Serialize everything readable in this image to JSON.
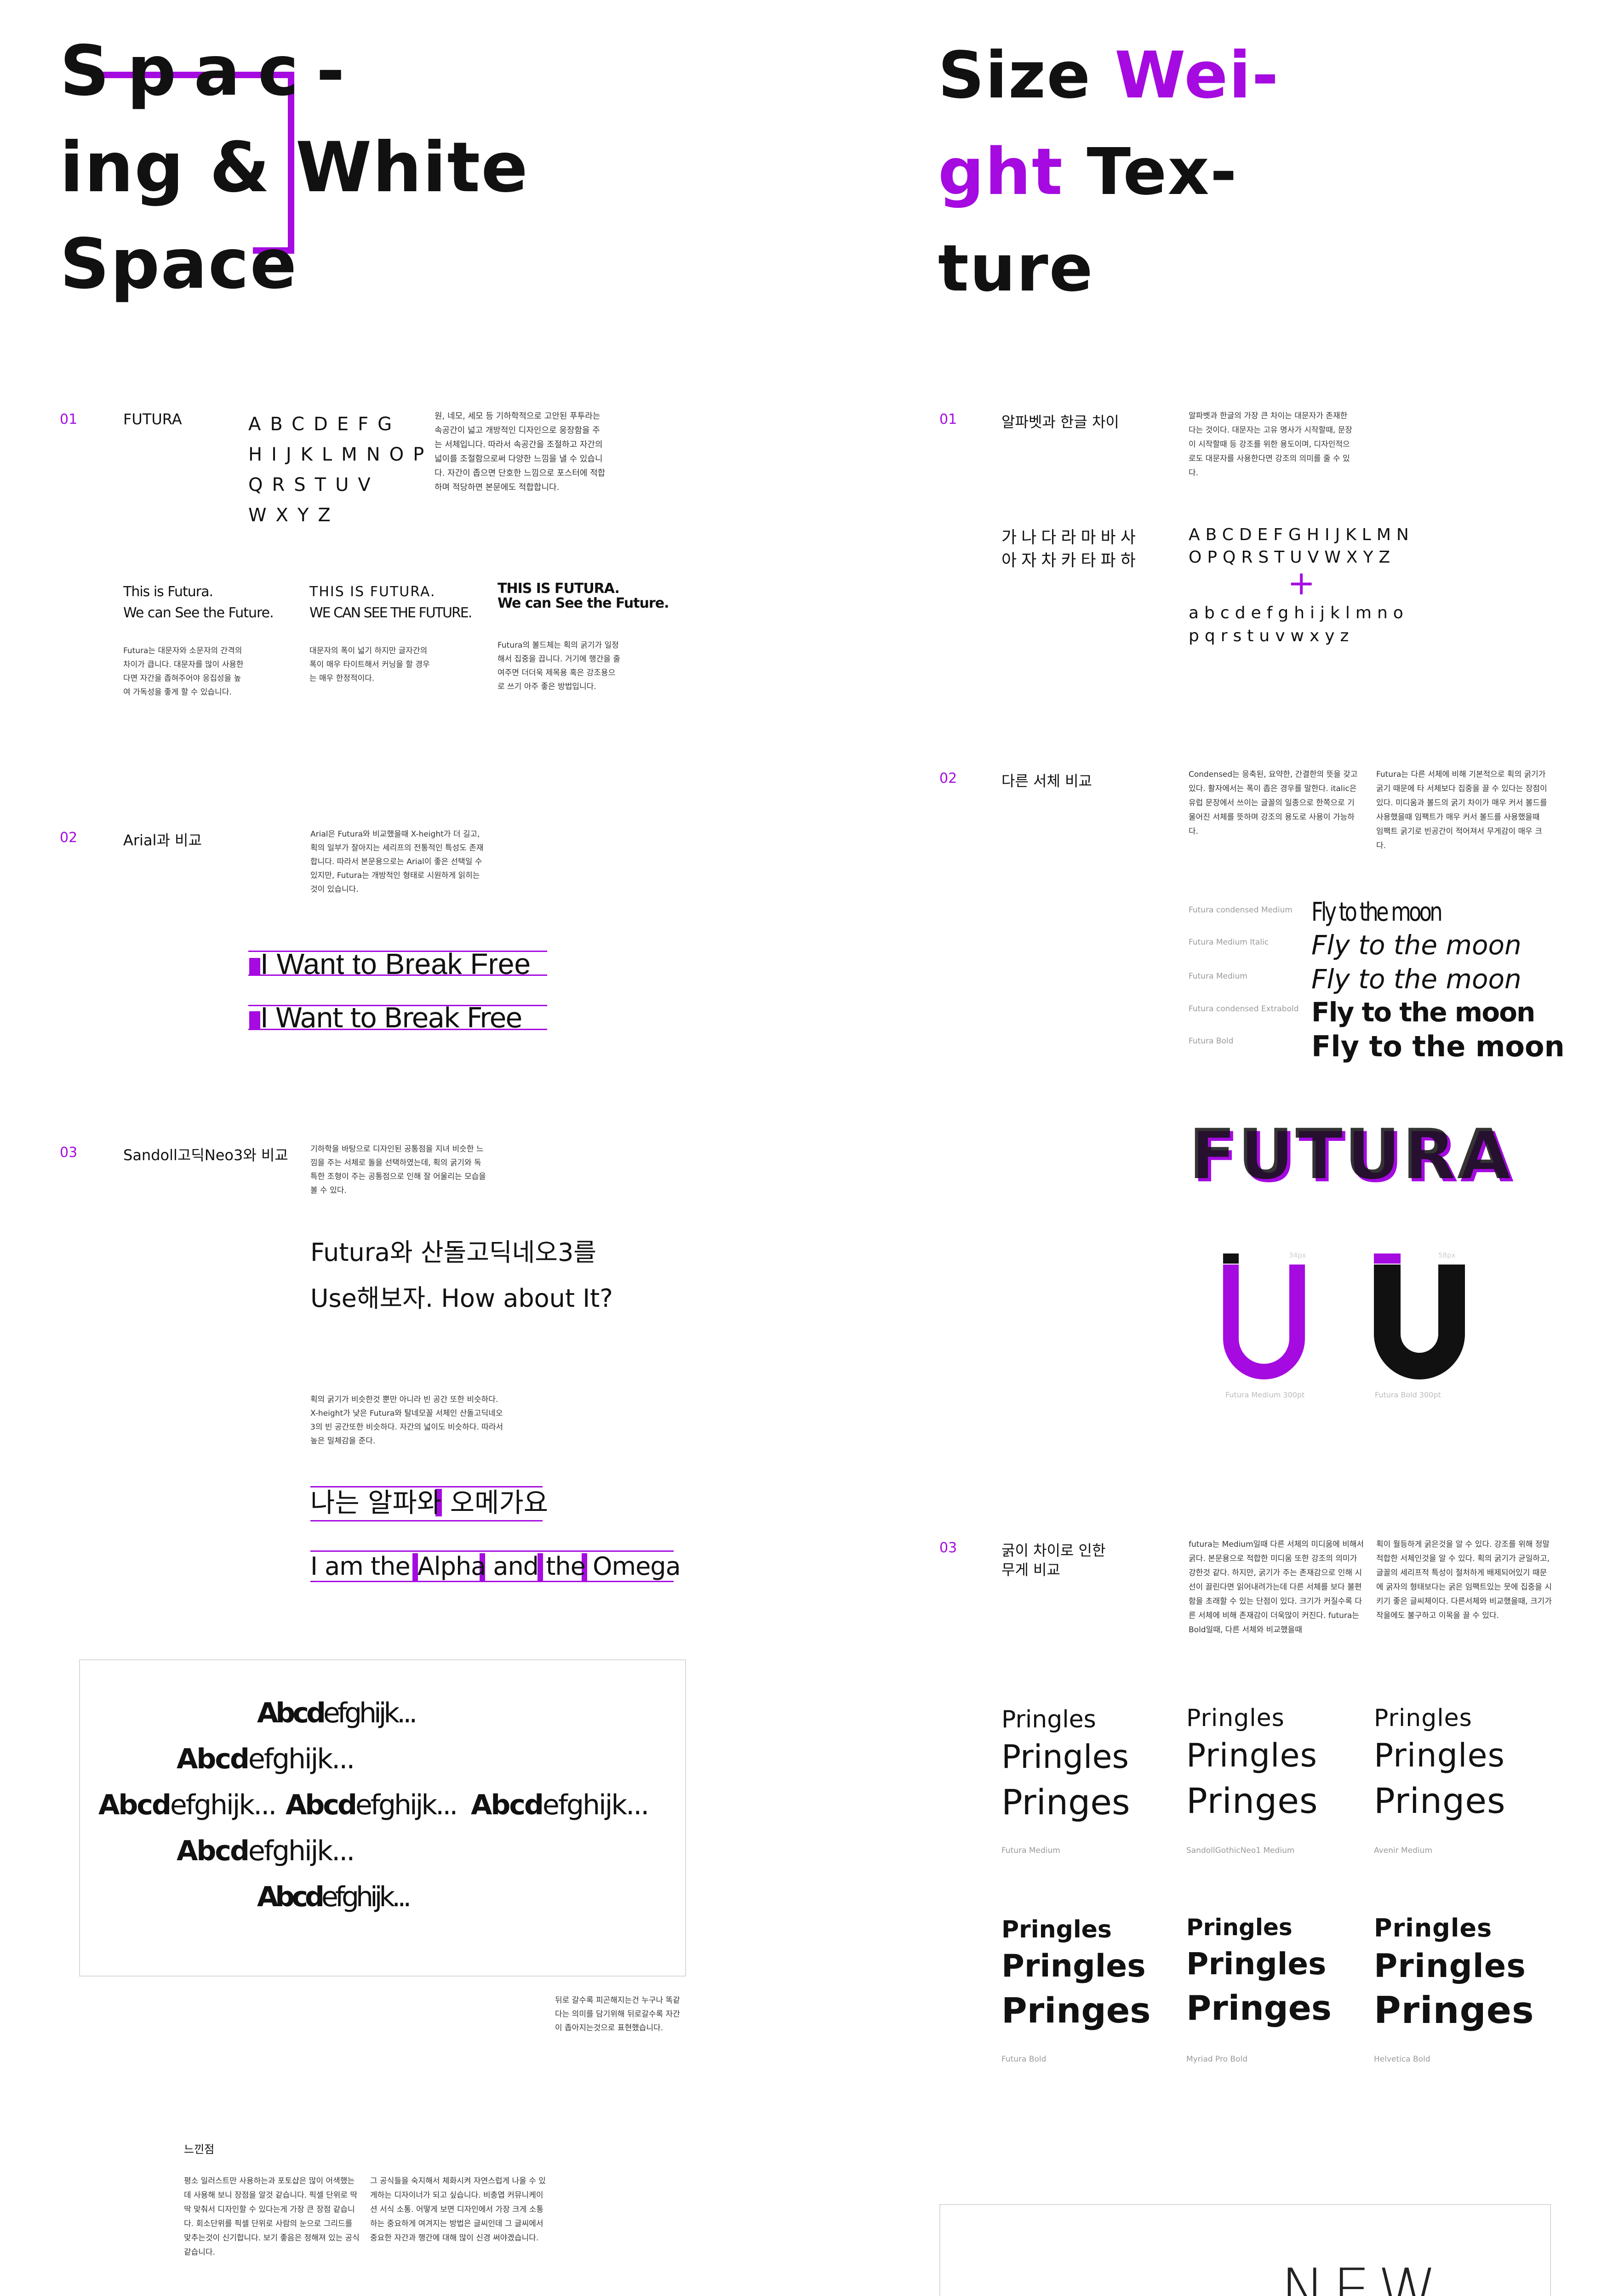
{
  "left": {
    "title_lines": [
      "Spac-",
      "ing & White",
      "Space"
    ],
    "s01": {
      "num": "01",
      "label": "FUTURA",
      "alpha_lines": [
        "ABCDEFG",
        "HIJKLMNOP",
        "QRSTUV",
        "WXYZ"
      ],
      "desc": "원, 네모, 세모 등 기하학적으로 고안된 푸투라는 속공간이 넓고 개방적인 디자인으로 웅장함을 주는 서체입니다. 따라서 속공간을 조절하고 자간의 넓이를 조절함으로써 다양한 느낌을 낼 수 있습니다. 자간이 좁으면 단호한 느낌으로 포스터에 적합하며 적당하면 본문에도 적합합니다.",
      "samples": [
        {
          "l1": "This is Futura.",
          "l2": "We can See the Future.",
          "desc": "Futura는 대문자와 소문자의 간격의 차이가 큽니다. 대문자를 많이 사용한다면 자간을 좁혀주어야 응집성을 높여 가독성을 좋게 할 수 있습니다."
        },
        {
          "l1": "THIS IS FUTURA.",
          "l2": "WE CAN SEE THE FUTURE.",
          "desc": "대문자의 폭이 넓기 하지만 글자간의 폭이 매우 타이트해서 커닝을 할 경우는 매우 한정적이다."
        },
        {
          "l1": "THIS IS FUTURA.",
          "l2": "We can See the Future.",
          "desc": "Futura의 볼드체는 획의 굵기가 일정해서 집중을 끕니다. 거기에 행간을 줄여주면 더더욱 제목용 혹은 강조용으로 쓰기 아주 좋은 방법입니다."
        }
      ]
    },
    "s02": {
      "num": "02",
      "label": "Arial과 비교",
      "desc": "Arial은 Futura와 비교했을때 X-height가 더 길고, 획의 일부가 잘아지는 세리프의 전통적인 특성도 존재합니다. 따라서 본문용으로는 Arial이 좋은 선택일 수 있지만, Futura는 개방적인 형태로 시원하게 읽히는 것이 있습니다.",
      "sample1": "I Want to Break Free",
      "sample2": "I Want to Break Free"
    },
    "s03": {
      "num": "03",
      "label": "Sandoll고딕Neo3와 비교",
      "desc": "기하학을 바탕으로 디자인된 공통점을 지녀 비슷한 느낌을 주는 서체로 돌을 선택하였는데, 획의 굵기와 독특한 조형이 주는 공통점으로 인해 잘 어울리는 모습을 볼 수 있다.",
      "big1": "Futura와 산돌고딕네오3를",
      "big2": "Use해보자. How about It?",
      "desc2": "획의 굵기가 비슷한것 뿐만 아니라 빈 공간 또한 비슷하다. X-height가 낮은 Futura와 탈네모꼴 서체인 산돌고딕네오3의 빈 공간또한 비슷하다. 자간의 넓이도 비슷하다. 따라서 높은 밀체감을 준다.",
      "kr_sample": "나는 알파와 오메가요",
      "en_sample": "I am the Alpha and the Omega"
    },
    "abc": {
      "bold": "Abcd",
      "rest": "efghijk..."
    },
    "caption": "뒤로 갈수록 피곤해지는건 누구나 똑같다는 의미를 담기위해 뒤로갈수록 자간이 좁아지는것으로 표현했습니다.",
    "feel": {
      "title": "느낀점",
      "p1": "평소 일러스트만 사용하는과 포토샵은 많이 어색했는데 사용해 보니 장점을 알것 같습니다. 픽셀 단위로 딱 딱 맞춰서 디자인할 수 있다는게 가장 큰 장점 같습니다. 회소단위를 픽셀 단위로 사람의 눈으로 그리드를 맞추는것이 신기합니다. 보기 좋음은 정해져 있는 공식 같습니다.",
      "p2": "그 공식들을 숙지해서 체화시켜 자연스럽게 나올 수 있게하는 디자이너가 되고 싶습니다. 비충엽 커뮤니케이션 서식 소통. 어떻게 보면 디자인에서 가장 크게 소통하는 중요하게 여겨지는 방법은 글씨인데 그 글씨에서 중요한 자간과 행간에 대해 많이 신경 써야겠습니다."
    }
  },
  "right": {
    "title": {
      "size": "Size",
      "wei": "Wei-",
      "ght": "ght",
      "tex": "Tex-",
      "ture": "ture"
    },
    "s01": {
      "num": "01",
      "label": "알파벳과 한글 차이",
      "desc": "알파벳과 한글의 가장 큰 차이는 대문자가 존재한다는 것이다. 대문자는 고유 명사가 시작할때, 문장이 시작할때 등 강조를 위한 용도이며, 디자인적으로도 대문자를 사용한다면 강조의 의미를 줄 수 있다.",
      "hangul1": "가나다라마바사",
      "hangul2": "아자차카타파하",
      "upper1": "ABCDEFGHIJKLMN",
      "upper2": "OPQRSTUVWXYZ",
      "plus": "+",
      "lower1": "abcdefghijklmno",
      "lower2": "pqrstuvwxyz"
    },
    "s02": {
      "num": "02",
      "label": "다른 서체 비교",
      "desc1": "Condensed는 응축된, 요약한, 간결한의 뜻을 갖고 있다. 활자에서는 폭이 좁은 경우를 말한다. italic은 유럽 문장에서 쓰이는 글꼴의 일종으로 한쪽으로 기울어진 서체를 뜻하며 강조의 용도로 사용이 가능하다.",
      "desc2": "Futura는 다른 서체에 비해 기본적으로 획의 굵기가 굵기 때문에 타 서체보다 집중을 끌 수 있다는 장점이 있다. 미디움과 볼드의 굵기 차이가 매우 커서 볼드를 사용했을때 임팩트가 매우 커서 볼드를 사용했을때 임팩트 굵기로 빈공간이 적어져서 무게감이 매우 크다.",
      "fly": [
        {
          "label": "Futura condensed Medium",
          "text": "Fly to the moon"
        },
        {
          "label": "Futura Medium Italic",
          "text": "Fly to the moon"
        },
        {
          "label": "Futura Medium",
          "text": "Fly to the moon"
        },
        {
          "label": "Futura condensed Extrabold",
          "text": "Fly to the moon"
        },
        {
          "label": "Futura Bold",
          "text": "Fly to the moon"
        }
      ],
      "futura": "FUTURA",
      "u_letter": "U",
      "u1_size": "34px",
      "u2_size": "58px",
      "u1_label": "Futura Medium 300pt",
      "u2_label": "Futura Bold 300pt"
    },
    "s03": {
      "num": "03",
      "label1": "굵이 차이로 인한",
      "label2": "무게 비교",
      "desc1": "futura는 Medium일때 다른 서체의 미디움에 비해서 굵다. 본문용으로 적합한 미디움 또한 강조의 의미가 강한것 같다. 하지만, 굵기가 주는 존재감으로 인해 시선이 끌린다면 읽어내려가는데 다른 서체를 보다 불편함을 초래할 수 있는 단점이 있다. 크기가 커질수록 다른 서체에 비해 존재감이 더욱많이 커진다. futura는 Bold일때, 다른 서체와 비교했을때",
      "desc2": "획이 월등하게 굵은것을 알 수 있다. 강조를 위해 정말 적합한 서체인것을 알 수 있다. 획의 굵기가 균일하고, 글꼴의 세리프적 특성이 절처하게 배제되어있기 때문에 굵자의 형태보다는 굵은 임팩트있는 뭇에 집중을 시키기 좋은 글씨체이다. 다른서체와 비교했을때, 크기가 작을에도 불구하고 이목을 끌 수 있다.",
      "pringles": [
        "Pringles",
        "Pringles",
        "Pringes"
      ],
      "medium_labels": [
        "Futura Medium",
        "SandollGothicNeo1 Medium",
        "Avenir Medium"
      ],
      "bold_labels": [
        "Futura Bold",
        "Myriad Pro Bold",
        "Helvetica Bold"
      ]
    },
    "new": "NEW"
  }
}
